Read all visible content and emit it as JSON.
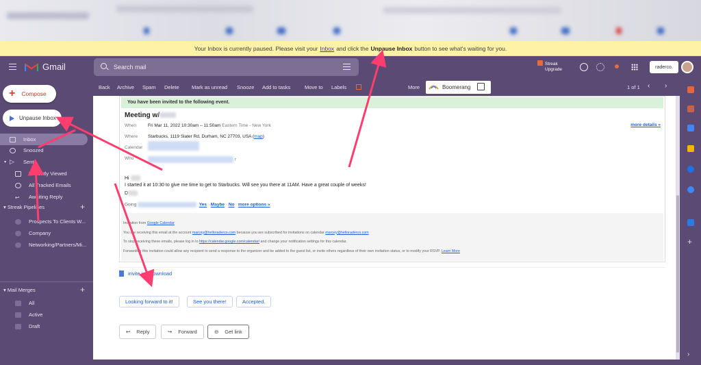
{
  "banner": {
    "pre": "Your Inbox is currently paused. Please visit your",
    "link": "Inbox",
    "mid": "and click the",
    "bold": "Unpause Inbox",
    "post": "button to see what's waiting for you."
  },
  "header": {
    "app_name": "Gmail",
    "search_placeholder": "Search mail",
    "streak_label": "Streak",
    "streak_sub": "Upgrade",
    "account_label": "raderco."
  },
  "sidebar": {
    "compose": "Compose",
    "unpause": "Unpause Inbox",
    "items": [
      {
        "label": "Inbox",
        "icon": "inbox-icon"
      },
      {
        "label": "Snoozed",
        "icon": "clock-icon"
      },
      {
        "label": "Sent",
        "icon": "send-icon"
      },
      {
        "label": "Recently Viewed",
        "icon": "inbox-icon"
      },
      {
        "label": "All Tracked Emails",
        "icon": "eye-icon"
      },
      {
        "label": "Awaiting Reply",
        "icon": "reply-icon"
      }
    ],
    "streak_section": "Streak Pipelines",
    "pipelines": [
      "Prospects To Clients W...",
      "Company",
      "Networking/Partners/Mi..."
    ],
    "mail_merges": "Mail Merges",
    "merges": [
      "All",
      "Active",
      "Draft"
    ]
  },
  "toolbar": {
    "back": "Back",
    "archive": "Archive",
    "spam": "Spam",
    "delete": "Delete",
    "unread": "Mark as unread",
    "snooze": "Snooze",
    "tasks": "Add to tasks",
    "move": "Move to",
    "labels": "Labels",
    "more": "More",
    "boomerang": "Boomerang",
    "count": "1 of 1"
  },
  "email": {
    "invited": "You have been invited to the following event.",
    "title": "Meeting w/",
    "when_label": "When",
    "when": "Fri Mar 11, 2022 10:30am – 11:50am",
    "tz": "Eastern Time - New York",
    "more_details": "more details »",
    "where_label": "Where",
    "where": "Starbucks, 1119 Slater Rd, Durham, NC 27703, USA",
    "map": "map",
    "calendar_label": "Calendar",
    "who_label": "Who",
    "who_suffix": "r",
    "greeting": "Hi",
    "body": "I started it at 10:30 to give me time to get to Starbucks. Will see you there at 11AM. Have a great couple of weeks!",
    "signoff": "D",
    "going": "Going",
    "yes": "Yes",
    "maybe": "Maybe",
    "no": "No",
    "more_options": "more options »",
    "footer1_pre": "Invitation from",
    "footer1_link": "Google Calendar",
    "footer2_pre": "You are receiving this email at the account",
    "footer2_email": "marcey@helloraderco.com",
    "footer2_mid": "because you are subscribed for invitations on calendar",
    "footer2_email2": "marcey@helloraderco.com",
    "footer3_pre": "To stop receiving these emails, please log in to",
    "footer3_link": "https://calendar.google.com/calendar/",
    "footer3_post": "and change your notification settings for this calendar.",
    "footer4": "Forwarding this invitation could allow any recipient to send a response to the organizer and be added to the guest list, or invite others regardless of their own invitation status, or to modify your RSVP.",
    "footer4_link": "Learn More",
    "attachment_name": "invite.ics",
    "attachment_action": "Download",
    "quick_replies": [
      "Looking forward to it!",
      "See you there!",
      "Accepted."
    ],
    "reply": "Reply",
    "forward": "Forward",
    "get_link": "Get link"
  },
  "colors": {
    "accent": "#ff3d6e",
    "sidebar_bg": "#5b4a73",
    "banner_bg": "#fef2a6"
  }
}
